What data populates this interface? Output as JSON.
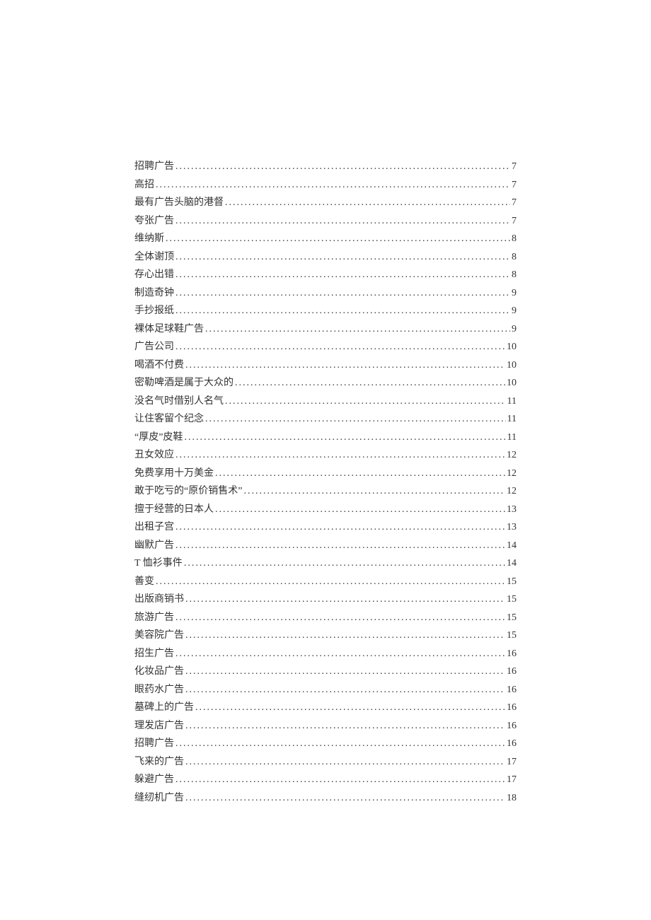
{
  "toc_entries": [
    {
      "title": "招聘广告",
      "page": "7"
    },
    {
      "title": "高招",
      "page": "7"
    },
    {
      "title": "最有广告头脑的港督",
      "page": "7"
    },
    {
      "title": "夸张广告",
      "page": "7"
    },
    {
      "title": "维纳斯",
      "page": "8"
    },
    {
      "title": "全体谢顶",
      "page": "8"
    },
    {
      "title": "存心出错",
      "page": "8"
    },
    {
      "title": "制造奇钟",
      "page": "9"
    },
    {
      "title": "手抄报纸",
      "page": "9"
    },
    {
      "title": "裸体足球鞋广告",
      "page": "9"
    },
    {
      "title": "广告公司",
      "page": "10"
    },
    {
      "title": "喝酒不付费",
      "page": "10"
    },
    {
      "title": "密勒啤酒是属于大众的",
      "page": "10"
    },
    {
      "title": "没名气时借别人名气",
      "page": "11"
    },
    {
      "title": "让住客留个纪念",
      "page": "11"
    },
    {
      "title": "“厚皮”皮鞋",
      "page": "11"
    },
    {
      "title": "丑女效应",
      "page": "12"
    },
    {
      "title": "免费享用十万美金",
      "page": "12"
    },
    {
      "title": "敢于吃亏的“原价销售术”",
      "page": "12"
    },
    {
      "title": "擅于经营的日本人",
      "page": "13"
    },
    {
      "title": "出租子宫",
      "page": "13"
    },
    {
      "title": "幽默广告",
      "page": "14"
    },
    {
      "title": "T 恤衫事件",
      "page": "14"
    },
    {
      "title": "善变",
      "page": "15"
    },
    {
      "title": "出版商销书",
      "page": "15"
    },
    {
      "title": "旅游广告",
      "page": "15"
    },
    {
      "title": "美容院广告",
      "page": "15"
    },
    {
      "title": "招生广告",
      "page": "16"
    },
    {
      "title": "化妆品广告",
      "page": "16"
    },
    {
      "title": "眼药水广告",
      "page": "16"
    },
    {
      "title": "墓碑上的广告",
      "page": "16"
    },
    {
      "title": "理发店广告",
      "page": "16"
    },
    {
      "title": "招聘广告",
      "page": "16"
    },
    {
      "title": "飞来的广告",
      "page": "17"
    },
    {
      "title": "躲避广告",
      "page": "17"
    },
    {
      "title": "缝纫机广告",
      "page": "18"
    }
  ]
}
